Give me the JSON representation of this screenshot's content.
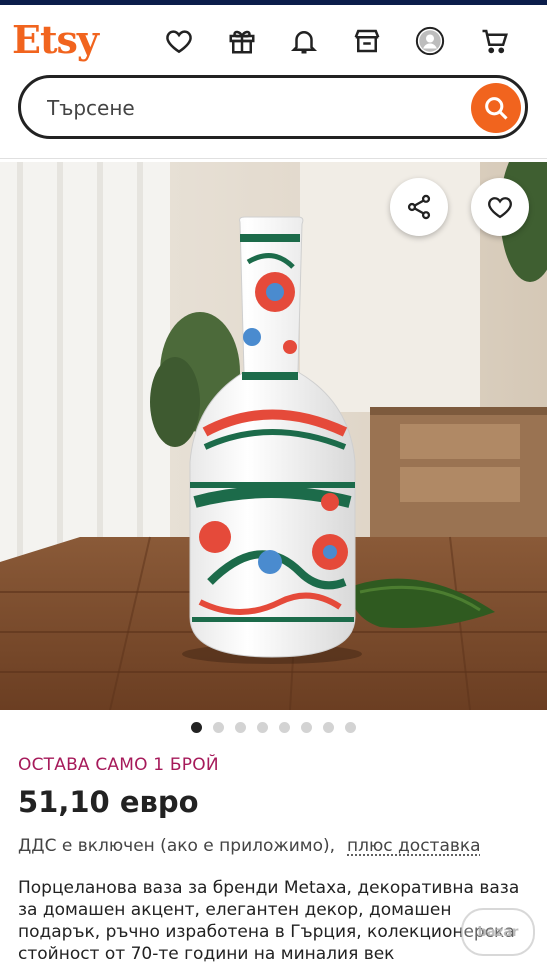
{
  "header": {
    "logo": "Etsy",
    "icons": [
      "heart-icon",
      "gift-icon",
      "bell-icon",
      "shop-icon",
      "avatar",
      "cart-icon"
    ]
  },
  "search": {
    "placeholder": "Търсене",
    "button_icon": "search-icon"
  },
  "hero": {
    "actions": [
      "share-icon",
      "favorite-heart-icon"
    ],
    "image_count": 8,
    "active_image": 1
  },
  "listing": {
    "stock_notice": "ОСТАВА САМО 1 БРОЙ",
    "price": "51,10 евро",
    "vat_note": "ДДС е включен (ако е приложимо),",
    "shipping_link": "плюс доставка",
    "description": "Порцеланова ваза за бренди Metaxa, декоративна ваза за домашен акцент, елегантен декор, домашен подарък, ръчно изработена в Гърция, колекционерска стойност от 70-те години на миналия век"
  },
  "colors": {
    "brand": "#f1641e",
    "stock_notice": "#a61a5a",
    "top_bar": "#0b1d4a"
  },
  "watermark": "bazar"
}
